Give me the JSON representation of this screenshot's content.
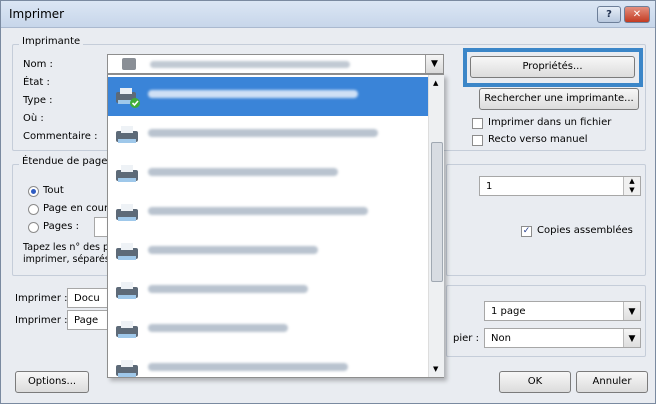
{
  "window": {
    "title": "Imprimer",
    "help": "?",
    "close": "✕"
  },
  "printer": {
    "group": "Imprimante",
    "name_label": "Nom :",
    "state_label": "État :",
    "type_label": "Type :",
    "where_label": "Où :",
    "comment_label": "Commentaire :",
    "properties_button": "Propriétés...",
    "find_button": "Rechercher une imprimante...",
    "print_to_file": "Imprimer dans un fichier",
    "manual_duplex": "Recto verso manuel"
  },
  "range": {
    "group": "Étendue de page",
    "all": "Tout",
    "current": "Page en cours",
    "pages": "Pages :",
    "hint1": "Tapez les n° des p",
    "hint2": "imprimer, séparés"
  },
  "copies": {
    "value": "1",
    "collate": "Copies assemblées"
  },
  "print_what": {
    "label1": "Imprimer :",
    "value1": "Docu",
    "label2": "Imprimer :",
    "value2": "Page"
  },
  "zoom": {
    "pages_per_sheet": "1 page",
    "scale_label": "pier :",
    "scale_value": "Non"
  },
  "buttons": {
    "options": "Options...",
    "ok": "OK",
    "cancel": "Annuler"
  },
  "colors": {
    "accent": "#3b86c8",
    "selection": "#3a84d8"
  }
}
